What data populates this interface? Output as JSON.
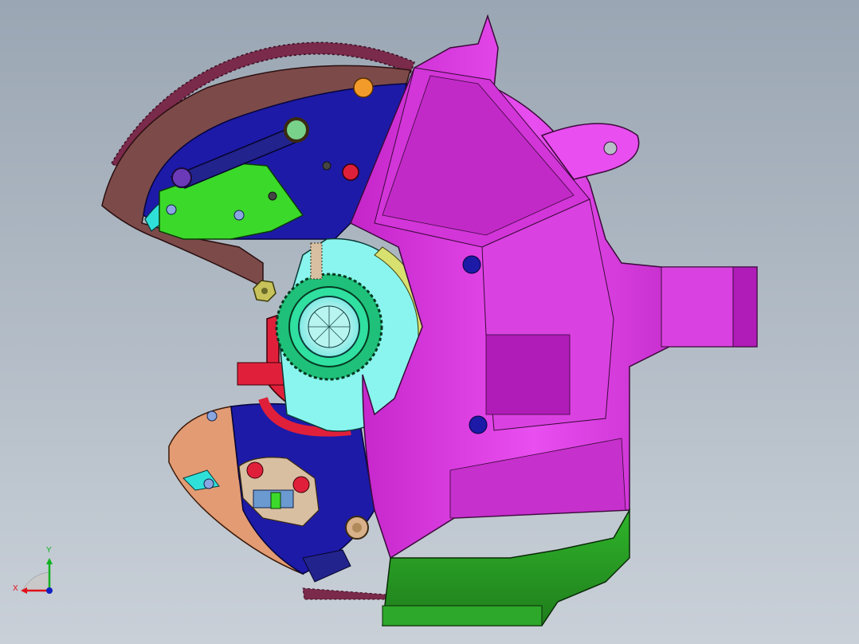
{
  "viewport": {
    "background_top": "#9aa6b3",
    "background_bottom": "#c9d0d8",
    "model_colors": {
      "housing": "#e23de8",
      "flywheel": "#7d4a4a",
      "ring_gear": "#7a2a4a",
      "plate": "#1d1aa8",
      "bottom_cover": "#2e9e2a",
      "lever": "#3bd92a",
      "hub": "#8af5ee",
      "seal": "#e0203a",
      "wedge": "#e39b74"
    }
  },
  "triad": {
    "x_label": "X",
    "y_label": "Y",
    "x_color": "#e0101a",
    "y_color": "#10b020",
    "z_color": "#1020c0"
  }
}
